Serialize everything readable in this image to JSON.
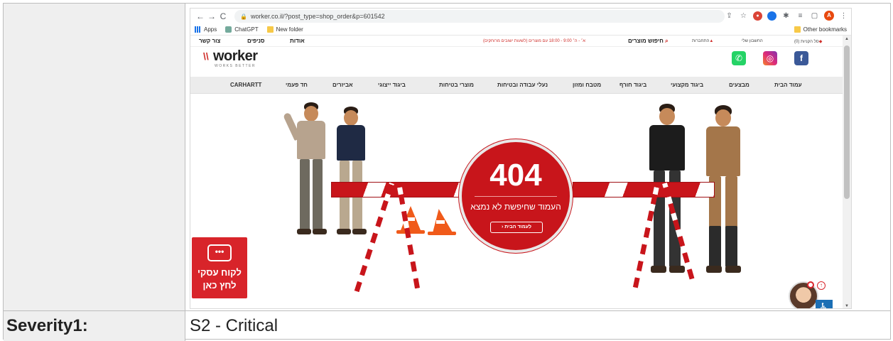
{
  "browser": {
    "url": "worker.co.il/?post_type=shop_order&p=601542",
    "back": "←",
    "forward": "→",
    "reload": "C",
    "bookmarks": [
      {
        "label": "Apps"
      },
      {
        "label": "ChatGPT"
      },
      {
        "label": "New folder"
      }
    ],
    "other_bookmarks": "Other bookmarks",
    "profile_initial": "A"
  },
  "site": {
    "topbar": {
      "contact": "צור קשר",
      "branches": "סניפים",
      "about": "אודות",
      "promo": "א׳ - ה׳ 9:00 - 18:00 עם מוצרים (לשעות ישובים מרוחקים)",
      "search": "חיפוש מוצרים",
      "login": "התחברות",
      "account": "החשבון שלי",
      "cart": "סל הקניות (0)"
    },
    "logo": {
      "name": "worker",
      "tagline": "WORKS BETTER"
    },
    "menu": [
      "עמוד הבית",
      "מבצעים",
      "ביגוד מקצועי",
      "ביגוד חורף",
      "מטבח ומזון",
      "נעלי עבודה ובטיחות",
      "מוצרי בטיחות",
      "ביגוד ייצוגי",
      "אביזרים",
      "חד פעמי",
      "CARHARTT"
    ],
    "error": {
      "code": "404",
      "message": "העמוד שחיפשת לא נמצא",
      "home_button": "לעמוד הבית"
    },
    "business": {
      "line1": "לקוח עסקי",
      "line2": "לחץ כאן"
    },
    "social_icons": [
      "facebook-icon",
      "instagram-icon",
      "whatsapp-icon"
    ],
    "colors": {
      "brand_red": "#c8151b",
      "menu_bg": "#ececec",
      "accessibility_blue": "#1b6fb5"
    }
  },
  "report": {
    "severity_label": "Severity1:",
    "severity_value": "S2 - Critical"
  }
}
